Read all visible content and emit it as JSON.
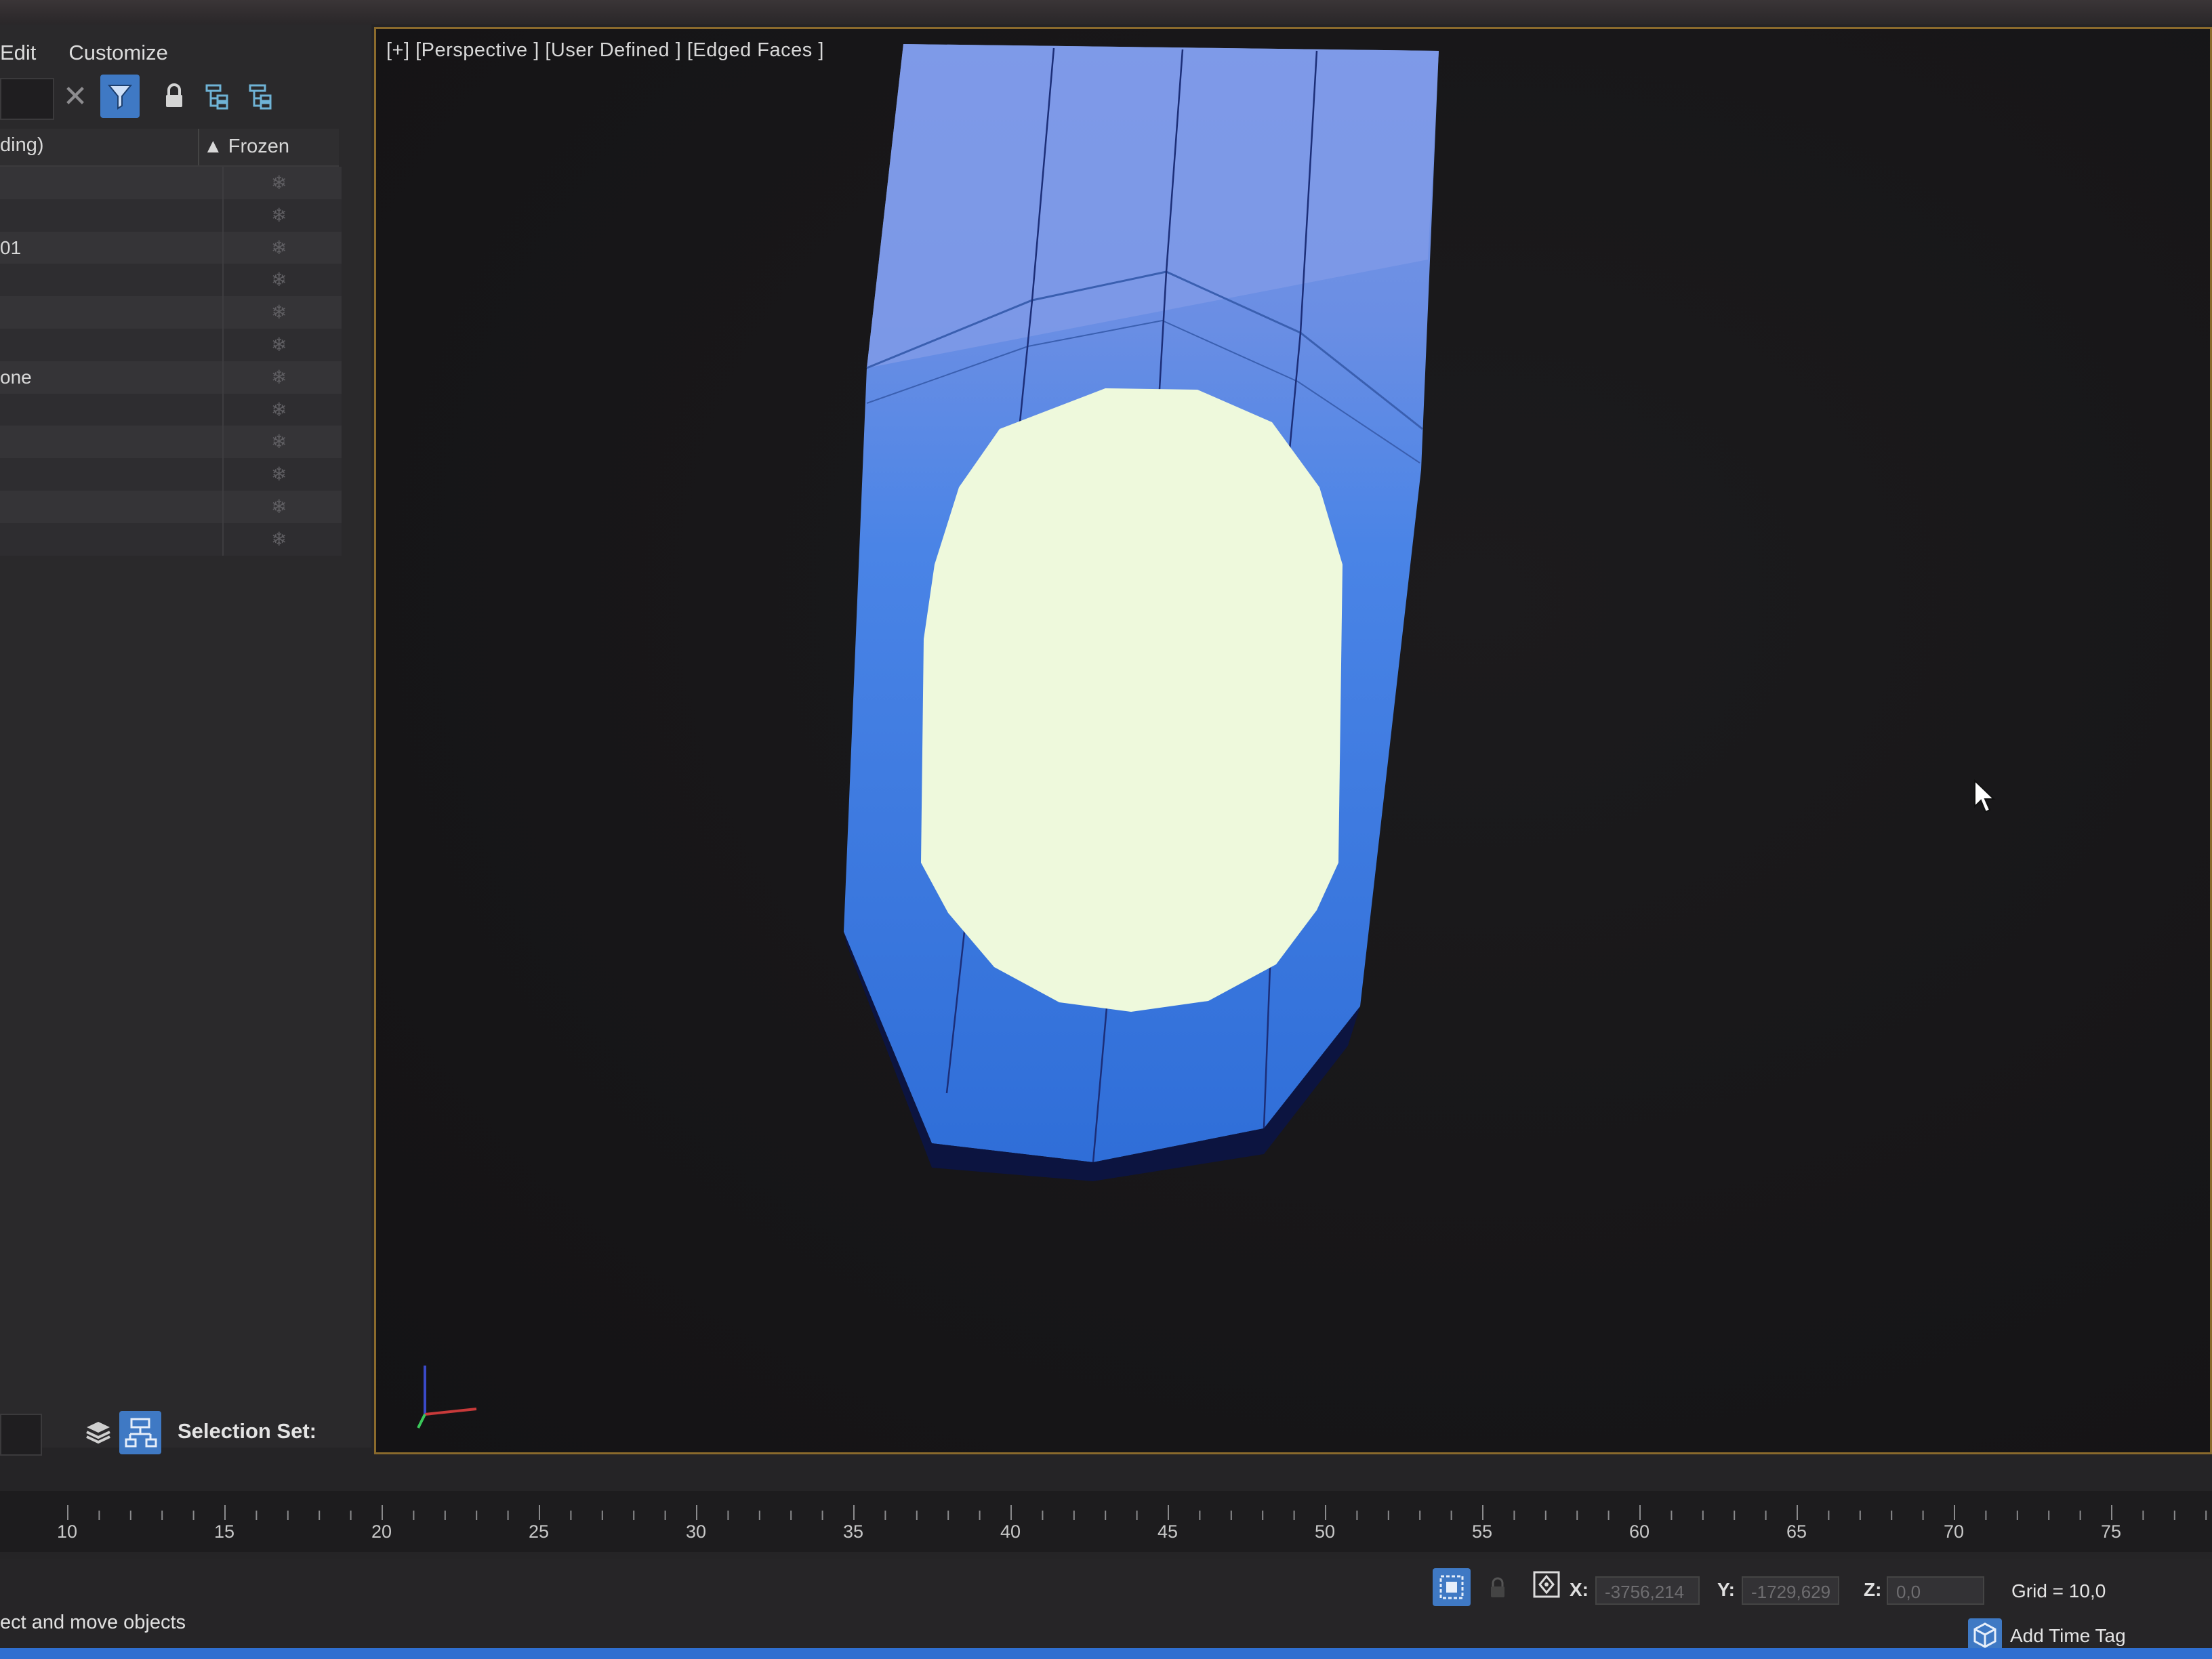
{
  "menu": {
    "edit": "Edit",
    "customize": "Customize"
  },
  "explorer": {
    "col_name": "ding)",
    "col_frozen": "▲ Frozen",
    "rows": [
      {
        "name": ""
      },
      {
        "name": ""
      },
      {
        "name": "01"
      },
      {
        "name": ""
      },
      {
        "name": ""
      },
      {
        "name": ""
      },
      {
        "name": "one"
      },
      {
        "name": ""
      },
      {
        "name": ""
      },
      {
        "name": ""
      },
      {
        "name": ""
      },
      {
        "name": ""
      }
    ],
    "selection_set_label": "Selection Set:"
  },
  "viewport": {
    "label": "[+] [Perspective ] [User Defined ] [Edged Faces ]",
    "object_color": "#3a7ff0",
    "face_color": "#eef9dc"
  },
  "timeline": {
    "labels": [
      "10",
      "15",
      "20",
      "25",
      "30",
      "35",
      "40",
      "45",
      "50",
      "55",
      "60",
      "65",
      "70",
      "75"
    ]
  },
  "status": {
    "prompt": "ect and move objects",
    "x_label": "X:",
    "x_value": "-3756,214",
    "y_label": "Y:",
    "y_value": "-1729,629",
    "z_label": "Z:",
    "z_value": "0,0",
    "grid": "Grid = 10,0",
    "time_tag": "Add Time Tag"
  },
  "colors": {
    "accent": "#3f79c4",
    "viewport_border": "#8a6a2c",
    "panel": "#2a292b"
  }
}
